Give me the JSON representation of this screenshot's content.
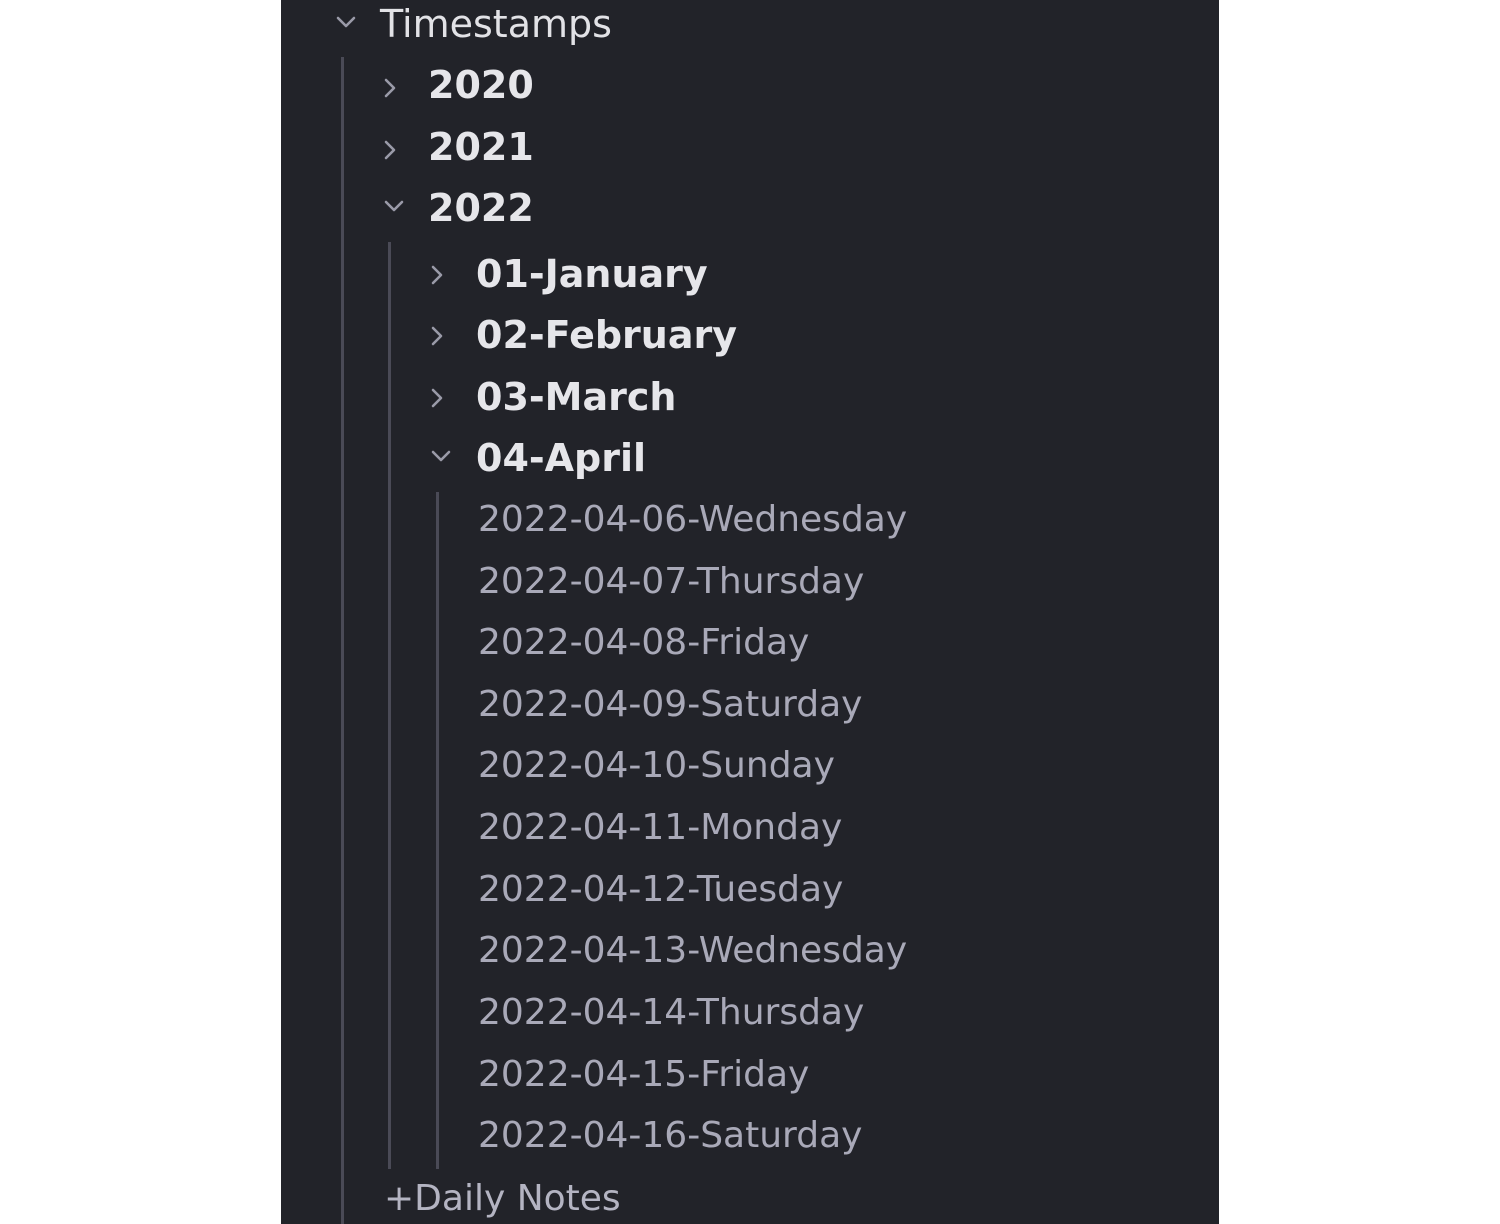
{
  "tree": {
    "root": {
      "label": "Timestamps",
      "expanded": true,
      "icon": "chevron-down-icon"
    },
    "years": [
      {
        "label": "2020",
        "expanded": false,
        "icon": "chevron-right-icon"
      },
      {
        "label": "2021",
        "expanded": false,
        "icon": "chevron-right-icon"
      },
      {
        "label": "2022",
        "expanded": true,
        "icon": "chevron-down-icon"
      }
    ],
    "months": [
      {
        "label": "01-January",
        "expanded": false,
        "icon": "chevron-right-icon"
      },
      {
        "label": "02-February",
        "expanded": false,
        "icon": "chevron-right-icon"
      },
      {
        "label": "03-March",
        "expanded": false,
        "icon": "chevron-right-icon"
      },
      {
        "label": "04-April",
        "expanded": true,
        "icon": "chevron-down-icon"
      }
    ],
    "notes": [
      "2022-04-06-Wednesday",
      "2022-04-07-Thursday",
      "2022-04-08-Friday",
      "2022-04-09-Saturday",
      "2022-04-10-Sunday",
      "2022-04-11-Monday",
      "2022-04-12-Tuesday",
      "2022-04-13-Wednesday",
      "2022-04-14-Thursday",
      "2022-04-15-Friday",
      "2022-04-16-Saturday"
    ],
    "footer": {
      "label": "+Daily Notes"
    }
  },
  "colors": {
    "background": "#222329",
    "folder_text": "#e6e6ea",
    "file_text": "#a9a9b8",
    "guide_line": "#4a4a56",
    "chevron": "#9a9aa8"
  }
}
